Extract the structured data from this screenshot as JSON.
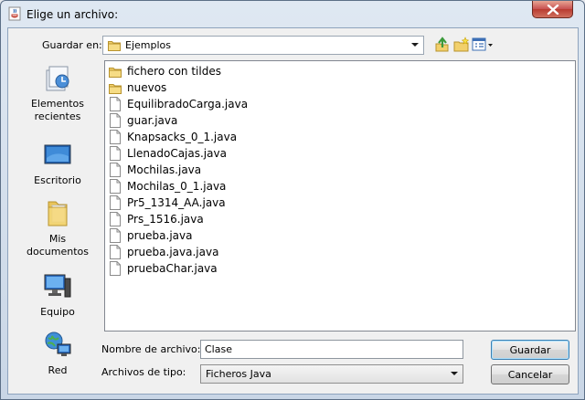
{
  "window": {
    "title": "Elige un archivo:"
  },
  "toolbar": {
    "save_in_label": "Guardar en:",
    "current_folder": "Ejemplos"
  },
  "places": [
    {
      "label_line1": "Elementos",
      "label_line2": "recientes",
      "icon": "recent-items-icon"
    },
    {
      "label_line1": "Escritorio",
      "label_line2": "",
      "icon": "desktop-icon"
    },
    {
      "label_line1": "Mis",
      "label_line2": "documentos",
      "icon": "documents-folder-icon"
    },
    {
      "label_line1": "Equipo",
      "label_line2": "",
      "icon": "computer-icon"
    },
    {
      "label_line1": "Red",
      "label_line2": "",
      "icon": "network-icon"
    }
  ],
  "files": [
    {
      "name": "fichero con tildes",
      "type": "folder"
    },
    {
      "name": "nuevos",
      "type": "folder"
    },
    {
      "name": "EquilibradoCarga.java",
      "type": "file"
    },
    {
      "name": "guar.java",
      "type": "file"
    },
    {
      "name": "Knapsacks_0_1.java",
      "type": "file"
    },
    {
      "name": "LlenadoCajas.java",
      "type": "file"
    },
    {
      "name": "Mochilas.java",
      "type": "file"
    },
    {
      "name": "Mochilas_0_1.java",
      "type": "file"
    },
    {
      "name": "Pr5_1314_AA.java",
      "type": "file"
    },
    {
      "name": "Prs_1516.java",
      "type": "file"
    },
    {
      "name": "prueba.java",
      "type": "file"
    },
    {
      "name": "prueba.java.java",
      "type": "file"
    },
    {
      "name": "pruebaChar.java",
      "type": "file"
    }
  ],
  "form": {
    "filename_label": "Nombre de archivo:",
    "filename_value": "Clase",
    "filetype_label": "Archivos de tipo:",
    "filetype_value": "Ficheros Java"
  },
  "buttons": {
    "save": "Guardar",
    "cancel": "Cancelar"
  }
}
